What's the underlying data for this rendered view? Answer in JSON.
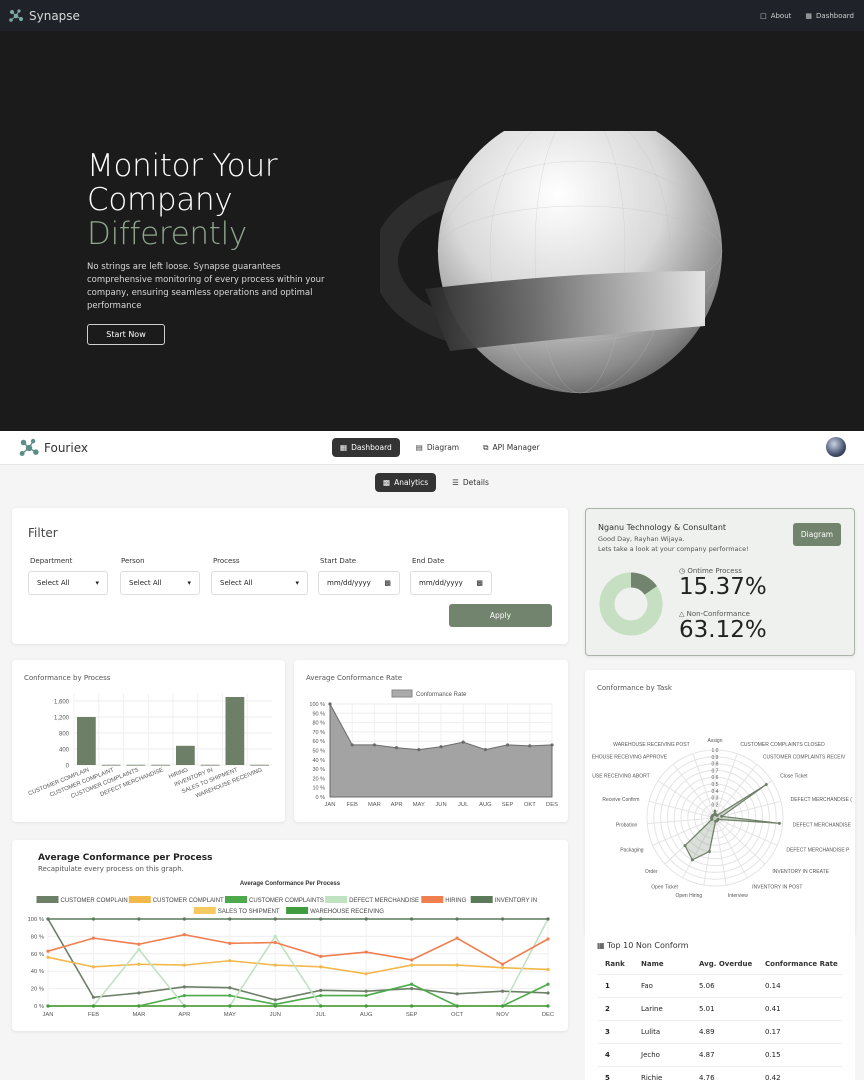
{
  "topbar": {
    "brand": "Synapse",
    "about": "About",
    "dashboard": "Dashboard"
  },
  "hero": {
    "line1": "Monitor Your",
    "line2": "Company",
    "line3": "Differently",
    "desc": "No strings are left loose. Synapse guarantees comprehensive monitoring of every process within your company, ensuring seamless operations and optimal performance",
    "cta": "Start Now"
  },
  "app": {
    "brand": "Fouriex",
    "tabs": [
      "Dashboard",
      "Diagram",
      "API Manager"
    ],
    "subtabs": [
      "Analytics",
      "Details"
    ]
  },
  "filter": {
    "title": "Filter",
    "fields": [
      {
        "label": "Department",
        "value": "Select All"
      },
      {
        "label": "Person",
        "value": "Select All"
      },
      {
        "label": "Process",
        "value": "Select All"
      },
      {
        "label": "Start Date",
        "value": "mm/dd/yyyy"
      },
      {
        "label": "End Date",
        "value": "mm/dd/yyyy"
      }
    ],
    "apply": "Apply"
  },
  "company": {
    "name": "Nganu Technology & Consultant",
    "greeting": "Good Day, Rayhan Wijaya.",
    "sub": "Lets take a look at your company performace!",
    "button": "Diagram",
    "ontime_label": "Ontime Process",
    "ontime_value": "15.37%",
    "nonconf_label": "Non-Conformance",
    "nonconf_value": "63.12%",
    "donut_fraction": 0.1537
  },
  "conf_by_process": {
    "title": "Conformance by Process"
  },
  "avg_rate": {
    "title": "Average Conformance Rate"
  },
  "avg_per_process": {
    "title": "Average Conformance per Process",
    "sub": "Recapitulate every process on this graph."
  },
  "conf_by_task": {
    "title": "Conformance by Task"
  },
  "top10": {
    "title": "Top 10 Non Conform",
    "headers": [
      "Rank",
      "Name",
      "Avg. Overdue",
      "Conformance Rate"
    ],
    "rows": [
      [
        "1",
        "Fao",
        "5.06",
        "0.14"
      ],
      [
        "2",
        "Larine",
        "5.01",
        "0.41"
      ],
      [
        "3",
        "Lulita",
        "4.89",
        "0.17"
      ],
      [
        "4",
        "Jecho",
        "4.87",
        "0.15"
      ],
      [
        "5",
        "Richie",
        "4.76",
        "0.42"
      ]
    ]
  },
  "colors": {
    "accent": "#72846d",
    "dark": "#1b1b1b"
  },
  "chart_data": [
    {
      "type": "bar",
      "categories": [
        "CUSTOMER COMPLAIN",
        "CUSTOMER COMPLAINT",
        "CUSTOMER COMPLAINTS",
        "DEFECT MERCHANDISE",
        "HIRING",
        "INVENTORY IN",
        "SALES TO SHIPMENT",
        "WAREHOUSE RECEIVING"
      ],
      "values": [
        1200,
        5,
        5,
        5,
        480,
        5,
        1700,
        5
      ],
      "ylim": [
        0,
        1800
      ],
      "yticks": [
        "0",
        "400",
        "800",
        "1,200",
        "1,600"
      ]
    },
    {
      "type": "area",
      "categories": [
        "JAN",
        "FEB",
        "MAR",
        "APR",
        "MAY",
        "JUN",
        "JUL",
        "AUG",
        "SEP",
        "OKT",
        "DES"
      ],
      "series": [
        {
          "name": "Conformance Rate",
          "values": [
            100,
            56,
            56,
            53,
            51,
            54,
            59,
            51,
            56,
            55,
            56
          ]
        }
      ],
      "ylim": [
        0,
        100
      ],
      "yticks": [
        "0 %",
        "10 %",
        "20 %",
        "30 %",
        "40 %",
        "50 %",
        "60 %",
        "70 %",
        "80 %",
        "90 %",
        "100 %"
      ]
    },
    {
      "type": "line",
      "title": "Average Conformance Per Process",
      "categories": [
        "JAN",
        "FEB",
        "MAR",
        "APR",
        "MAY",
        "JUN",
        "JUL",
        "AUG",
        "SEP",
        "OCT",
        "NOV",
        "DEC"
      ],
      "ylim": [
        0,
        100
      ],
      "yticks": [
        "0 %",
        "20 %",
        "40 %",
        "60 %",
        "80 %",
        "100 %"
      ],
      "series": [
        {
          "name": "CUSTOMER COMPLAIN",
          "color": "#6e7f68",
          "values": [
            100,
            10,
            15,
            22,
            21,
            7,
            18,
            17,
            20,
            14,
            17,
            15
          ]
        },
        {
          "name": "CUSTOMER COMPLAINT",
          "color": "#f2b84b",
          "values": [
            56,
            45,
            48,
            47,
            52,
            47,
            45,
            37,
            47,
            47,
            44,
            42
          ]
        },
        {
          "name": "CUSTOMER COMPLAINTS",
          "color": "#4caa4c",
          "values": [
            0,
            0,
            0,
            12,
            12,
            2,
            12,
            12,
            25,
            0,
            0,
            25
          ]
        },
        {
          "name": "DEFECT MERCHANDISE",
          "color": "#bfe3c0",
          "values": [
            0,
            0,
            65,
            0,
            0,
            80,
            0,
            0,
            0,
            0,
            0,
            100
          ]
        },
        {
          "name": "HIRING",
          "color": "#f07f50",
          "values": [
            63,
            78,
            71,
            82,
            72,
            73,
            57,
            62,
            53,
            78,
            48,
            77
          ]
        },
        {
          "name": "INVENTORY IN",
          "color": "#5a7a5a",
          "values": [
            100,
            100,
            100,
            100,
            100,
            100,
            100,
            100,
            100,
            100,
            100,
            100
          ]
        },
        {
          "name": "SALES TO SHIPMENT",
          "color": "#f6c862",
          "values": [
            0,
            0,
            0,
            0,
            0,
            0,
            0,
            0,
            0,
            0,
            0,
            0
          ]
        },
        {
          "name": "WAREHOUSE RECEIVING",
          "color": "#3f9c3f",
          "values": [
            0,
            0,
            0,
            0,
            0,
            0,
            0,
            0,
            0,
            0,
            0,
            0
          ]
        }
      ]
    },
    {
      "type": "radar",
      "labels": [
        "Assign",
        "CUSTOMER COMPLAINTS CLOSED",
        "CUSTOMER COMPLAINTS RECEIV",
        "Close Ticket",
        "DEFECT MERCHANDISE (",
        "DEFECT MERCHANDISE",
        "DEFECT MERCHANDISE P",
        "INVENTORY IN CREATE",
        "INVENTORY IN POST",
        "Interview",
        "Open Hiring",
        "Open Ticket",
        "Order",
        "Packaging",
        "Probation",
        "Receive Confirm",
        "USE RECEIVING ABORT",
        "EHOUSE RECEIVING APPROVE",
        "WAREHOUSE RECEIVING POST"
      ],
      "values": [
        0.1,
        0.05,
        0.05,
        0.9,
        0.1,
        0.95,
        0.05,
        0.05,
        0.05,
        0.05,
        0.5,
        0.7,
        0.6,
        0.05,
        0.05,
        0.05,
        0.05,
        0.05,
        0.05
      ],
      "rticks": [
        "0.2",
        "0.3",
        "0.4",
        "0.5",
        "0.6",
        "0.7",
        "0.8",
        "0.9",
        "1.0"
      ]
    }
  ]
}
